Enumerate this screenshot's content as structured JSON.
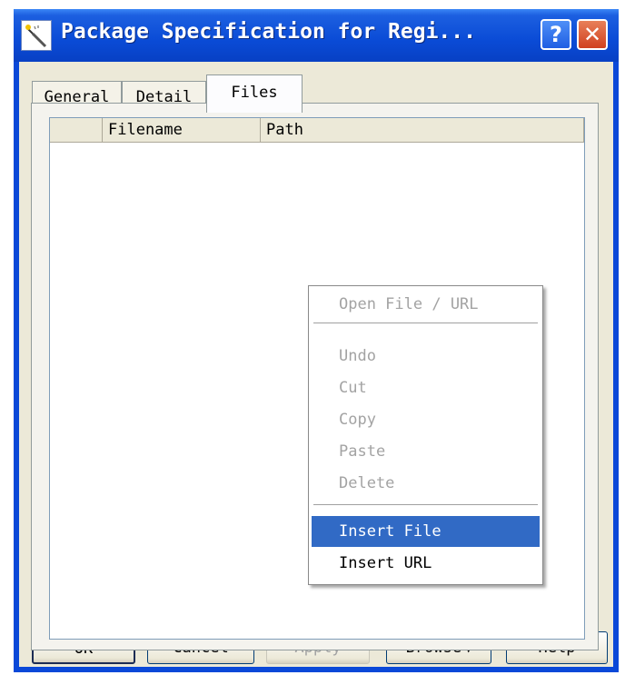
{
  "window": {
    "title": "Package Specification for Regi...",
    "help_glyph": "?",
    "close_glyph": "✕"
  },
  "tabs": [
    {
      "label": "General",
      "active": false
    },
    {
      "label": "Detail",
      "active": false
    },
    {
      "label": "Files",
      "active": true
    }
  ],
  "files_table": {
    "columns": [
      "",
      "Filename",
      "Path"
    ],
    "rows": []
  },
  "context_menu": {
    "items": [
      {
        "label": "Open File / URL",
        "enabled": false
      },
      {
        "label": "Undo",
        "enabled": false
      },
      {
        "label": "Cut",
        "enabled": false
      },
      {
        "label": "Copy",
        "enabled": false
      },
      {
        "label": "Paste",
        "enabled": false
      },
      {
        "label": "Delete",
        "enabled": false
      },
      {
        "label": "Insert File",
        "enabled": true,
        "highlighted": true
      },
      {
        "label": "Insert URL",
        "enabled": true
      }
    ]
  },
  "buttons": {
    "ok": "OK",
    "cancel": "Cancel",
    "apply": "Apply",
    "browse": "Browse",
    "browse_arrow": "▼",
    "help": "Help"
  }
}
